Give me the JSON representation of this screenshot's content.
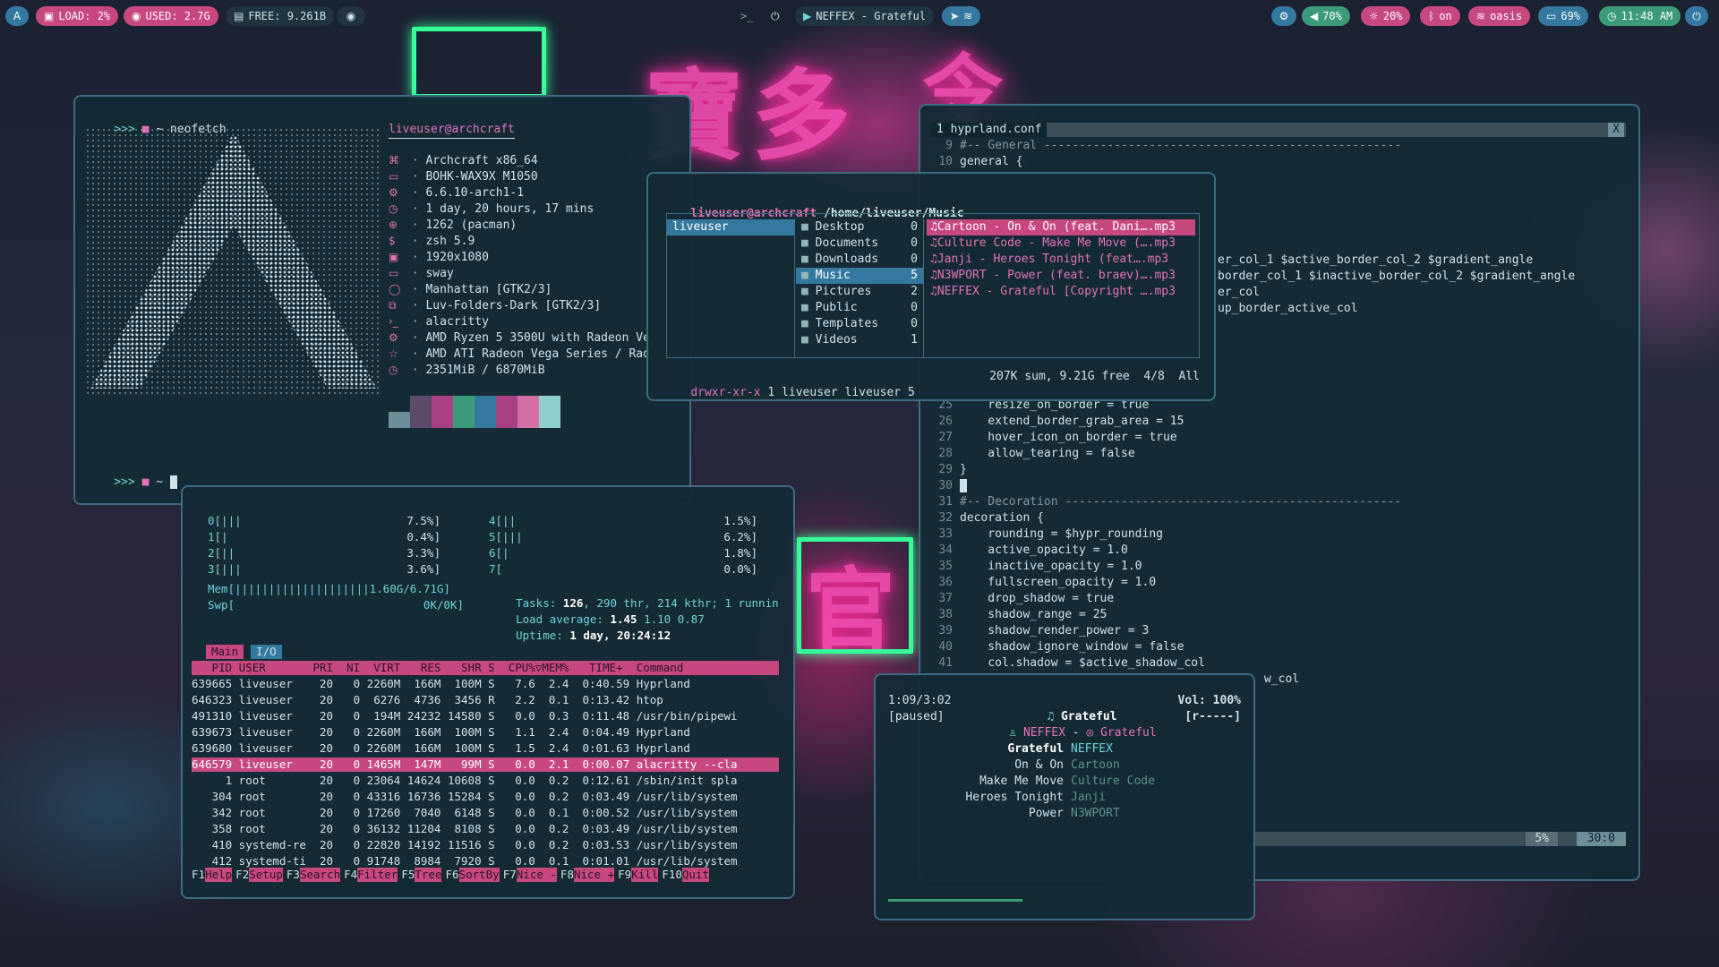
{
  "topbar": {
    "left": [
      {
        "icon": "arch-logo",
        "label": "A"
      },
      {
        "icon": "load-icon",
        "label": "LOAD: 2%"
      },
      {
        "icon": "memory-icon",
        "label": "USED: 2.7G"
      },
      {
        "icon": "disk-icon",
        "label": "FREE: 9.261B"
      },
      {
        "icon": "eye-icon",
        "label": ""
      }
    ],
    "center": {
      "prompt": ">_",
      "power": "⏻",
      "track": "NEFFEX - Grateful"
    },
    "right": [
      {
        "icon": "volume-icon",
        "label": "70%"
      },
      {
        "icon": "brightness-icon",
        "label": "20%"
      },
      {
        "icon": "bluetooth-icon",
        "label": "on"
      },
      {
        "icon": "wifi-icon",
        "label": "oasis"
      },
      {
        "icon": "battery-icon",
        "label": "69%"
      },
      {
        "icon": "clock-icon",
        "label": "11:48 AM"
      }
    ]
  },
  "neofetch": {
    "prompt": ">>> ",
    "command": "~ neofetch",
    "user": "liveuser@archcraft",
    "info": [
      "Archcraft x86_64",
      "BOHK-WAX9X M1050",
      "6.6.10-arch1-1",
      "1 day, 20 hours, 17 mins",
      "1262 (pacman)",
      "zsh 5.9",
      "1920x1080",
      "sway",
      "Manhattan [GTK2/3]",
      "Luv-Folders-Dark [GTK2/3]",
      "alacritty",
      "AMD Ryzen 5 3500U with Radeon Ve",
      "AMD ATI Radeon Vega Series / Rad",
      "2351MiB / 6870MiB"
    ],
    "info_icons": [
      "⌘",
      "▭",
      "⚙",
      "◷",
      "⊕",
      "$",
      "▣",
      "▭",
      "◯",
      "⧉",
      "›_",
      "⚙",
      "☆",
      "◷"
    ],
    "palette": [
      "#6d8d98",
      "#5d4a66",
      "#a83f82",
      "#3b9b78",
      "#35789f",
      "#a83f82",
      "#d36fa3",
      "#8fd0cc"
    ],
    "prompt2": ">>> ",
    "cwd": "~"
  },
  "htop": {
    "cpus": [
      {
        "id": "0",
        "bar": "[|||",
        "val": "7.5%]",
        "id2": "4",
        "bar2": "[||",
        "val2": "1.5%]"
      },
      {
        "id": "1",
        "bar": "[|",
        "val": "0.4%]",
        "id2": "5",
        "bar2": "[|||",
        "val2": "6.2%]"
      },
      {
        "id": "2",
        "bar": "[||",
        "val": "3.3%]",
        "id2": "6",
        "bar2": "[|",
        "val2": "1.8%]"
      },
      {
        "id": "3",
        "bar": "[|||",
        "val": "3.6%]",
        "id2": "7",
        "bar2": "[",
        "val2": "0.0%]"
      }
    ],
    "mem": "Mem[||||||||||||||||||||1.60G/6.71G]",
    "swp": "Swp[                            0K/0K]",
    "tasks_label": "Tasks: ",
    "tasks": "126",
    "tasks_rest": ", 290 thr, 214 kthr; 1 runnin",
    "load_label": "Load average: ",
    "load1": "1.45",
    "load_rest": " 1.10 0.87",
    "uptime_label": "Uptime: ",
    "uptime": "1 day, 20:24:12",
    "tabs": [
      "Main",
      "I/O"
    ],
    "header": "   PID USER       PRI  NI  VIRT   RES   SHR S  CPU%▽MEM%   TIME+  Command",
    "rows": [
      "639665 liveuser    20   0 2260M  166M  100M S   7.6  2.4  0:40.59 Hyprland",
      "646323 liveuser    20   0  6276  4736  3456 R   2.2  0.1  0:13.42 htop",
      "491310 liveuser    20   0  194M 24232 14580 S   0.0  0.3  0:11.48 /usr/bin/pipewi",
      "639673 liveuser    20   0 2260M  166M  100M S   1.1  2.4  0:04.49 Hyprland",
      "639680 liveuser    20   0 2260M  166M  100M S   1.5  2.4  0:01.63 Hyprland",
      "646579 liveuser    20   0 1465M  147M   99M S   0.0  2.1  0:00.07 alacritty --cla",
      "     1 root        20   0 23064 14624 10608 S   0.0  0.2  0:12.61 /sbin/init spla",
      "   304 root        20   0 43316 16736 15284 S   0.0  0.2  0:03.49 /usr/lib/system",
      "   342 root        20   0 17260  7040  6148 S   0.0  0.1  0:00.52 /usr/lib/system",
      "   358 root        20   0 36132 11204  8108 S   0.0  0.2  0:03.49 /usr/lib/system",
      "   410 systemd-re  20   0 22820 14192 11516 S   0.0  0.2  0:03.53 /usr/lib/system",
      "   412 systemd-ti  20   0 91748  8984  7920 S   0.0  0.1  0:01.01 /usr/lib/system"
    ],
    "fkeys": [
      {
        "k": "F1",
        "l": "Help"
      },
      {
        "k": "F2",
        "l": "Setup"
      },
      {
        "k": "F3",
        "l": "Search"
      },
      {
        "k": "F4",
        "l": "Filter"
      },
      {
        "k": "F5",
        "l": "Tree"
      },
      {
        "k": "F6",
        "l": "SortBy"
      },
      {
        "k": "F7",
        "l": "Nice -"
      },
      {
        "k": "F8",
        "l": "Nice +"
      },
      {
        "k": "F9",
        "l": "Kill"
      },
      {
        "k": "F10",
        "l": "Quit"
      }
    ]
  },
  "ranger": {
    "title_user": "liveuser@archcraft",
    "title_path": " /home/liveuser/Music",
    "col1": [
      {
        "name": "liveuser",
        "count": ""
      }
    ],
    "col2": [
      {
        "name": "Desktop",
        "count": "0"
      },
      {
        "name": "Documents",
        "count": "0"
      },
      {
        "name": "Downloads",
        "count": "0"
      },
      {
        "name": "Music",
        "count": "5"
      },
      {
        "name": "Pictures",
        "count": "2"
      },
      {
        "name": "Public",
        "count": "0"
      },
      {
        "name": "Templates",
        "count": "0"
      },
      {
        "name": "Videos",
        "count": "1"
      }
    ],
    "col3": [
      "Cartoon - On & On (feat. Dani….mp3",
      "Culture Code - Make Me Move (….mp3",
      "Janji - Heroes Tonight (feat….mp3",
      "N3WPORT - Power (feat. braev)….mp3",
      "NEFFEX - Grateful [Copyright ….mp3"
    ],
    "status_perm": "drwxr-xr-x",
    "status_rest": " 1 liveuser liveuser 5",
    "status_right": "207K sum, 9.21G free  4/8  All"
  },
  "editor": {
    "tab": "1 hyprland.conf",
    "close": "X",
    "lines": [
      {
        "n": "9",
        "t": "#-- General ---------------------------------------------------"
      },
      {
        "n": "10",
        "t": "general {"
      }
    ],
    "partial": [
      "er_col_1 $active_border_col_2 $gradient_angle",
      "border_col_1 $inactive_border_col_2 $gradient_angle",
      "er_col",
      "up_border_active_col"
    ],
    "lines2": [
      {
        "n": "25",
        "t": "    resize_on_border = true"
      },
      {
        "n": "26",
        "t": "    extend_border_grab_area = 15"
      },
      {
        "n": "27",
        "t": "    hover_icon_on_border = true"
      },
      {
        "n": "28",
        "t": "    allow_tearing = false"
      },
      {
        "n": "29",
        "t": "}"
      },
      {
        "n": "30",
        "t": ""
      },
      {
        "n": "31",
        "t": "#-- Decoration ------------------------------------------------"
      },
      {
        "n": "32",
        "t": "decoration {"
      },
      {
        "n": "33",
        "t": "    rounding = $hypr_rounding"
      },
      {
        "n": "34",
        "t": "    active_opacity = 1.0"
      },
      {
        "n": "35",
        "t": "    inactive_opacity = 1.0"
      },
      {
        "n": "36",
        "t": "    fullscreen_opacity = 1.0"
      },
      {
        "n": "37",
        "t": "    drop_shadow = true"
      },
      {
        "n": "38",
        "t": "    shadow_range = 25"
      },
      {
        "n": "39",
        "t": "    shadow_render_power = 3"
      },
      {
        "n": "40",
        "t": "    shadow_ignore_window = false"
      },
      {
        "n": "41",
        "t": "    col.shadow = $active_shadow_col"
      }
    ],
    "tail": "w_col",
    "status_pct": "5%",
    "status_pos": "30:0"
  },
  "music": {
    "time": "1:09/3:02",
    "state": "[paused]",
    "title": "Grateful",
    "artist": "NEFFEX",
    "sep": " - ",
    "album": "Grateful",
    "vol": "Vol: 100%",
    "mode": "[r-----]",
    "playlist": [
      {
        "title": "Grateful",
        "artist": "NEFFEX"
      },
      {
        "title": "On & On",
        "artist": "Cartoon"
      },
      {
        "title": "Make Me Move",
        "artist": "Culture Code"
      },
      {
        "title": "Heroes Tonight",
        "artist": "Janji"
      },
      {
        "title": "Power",
        "artist": "N3WPORT"
      }
    ],
    "progress": 0.38
  },
  "colors": {
    "accent": "#c7477f",
    "cyan": "#6fd3d8",
    "green": "#3b9b78",
    "blue": "#35789f"
  }
}
